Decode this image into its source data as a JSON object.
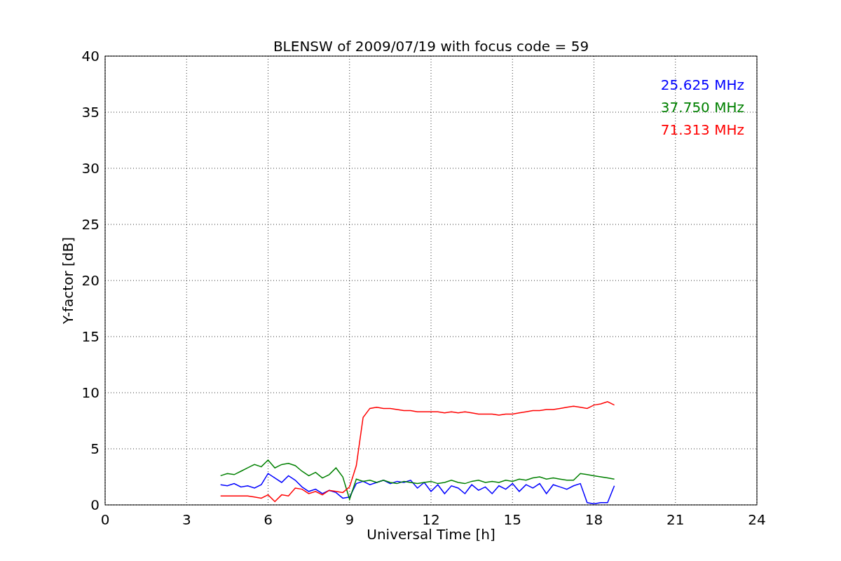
{
  "chart_data": {
    "type": "line",
    "title": "BLENSW of 2009/07/19 with focus code = 59",
    "xlabel": "Universal Time [h]",
    "ylabel": "Y-factor [dB]",
    "xlim": [
      0,
      24
    ],
    "ylim": [
      0,
      40
    ],
    "xticks": [
      0,
      3,
      6,
      9,
      12,
      15,
      18,
      21,
      24
    ],
    "yticks": [
      0,
      5,
      10,
      15,
      20,
      25,
      30,
      35,
      40
    ],
    "grid": true,
    "x": [
      4.25,
      4.5,
      4.75,
      5,
      5.25,
      5.5,
      5.75,
      6,
      6.25,
      6.5,
      6.75,
      7,
      7.25,
      7.5,
      7.75,
      8,
      8.25,
      8.5,
      8.75,
      9,
      9.25,
      9.5,
      9.75,
      10,
      10.25,
      10.5,
      10.75,
      11,
      11.25,
      11.5,
      11.75,
      12,
      12.25,
      12.5,
      12.75,
      13,
      13.25,
      13.5,
      13.75,
      14,
      14.25,
      14.5,
      14.75,
      15,
      15.25,
      15.5,
      15.75,
      16,
      16.25,
      16.5,
      16.75,
      17,
      17.25,
      17.5,
      17.75,
      18,
      18.25,
      18.5,
      18.75
    ],
    "series": [
      {
        "name": "25.625 MHz",
        "color": "#0000ff",
        "values": [
          1.8,
          1.7,
          1.9,
          1.6,
          1.7,
          1.5,
          1.8,
          2.8,
          2.4,
          2.0,
          2.6,
          2.2,
          1.6,
          1.2,
          1.4,
          1.0,
          1.3,
          1.1,
          0.6,
          0.7,
          1.9,
          2.1,
          1.8,
          2.0,
          2.2,
          1.9,
          2.1,
          2.0,
          2.2,
          1.5,
          2.0,
          1.2,
          1.8,
          1.0,
          1.7,
          1.5,
          1.0,
          1.8,
          1.3,
          1.6,
          1.0,
          1.7,
          1.4,
          1.9,
          1.2,
          1.8,
          1.5,
          1.9,
          1.0,
          1.8,
          1.6,
          1.4,
          1.7,
          1.9,
          0.2,
          0.1,
          0.2,
          0.2,
          1.7
        ]
      },
      {
        "name": "37.750 MHz",
        "color": "#008000",
        "values": [
          2.6,
          2.8,
          2.7,
          3.0,
          3.3,
          3.6,
          3.4,
          4.0,
          3.3,
          3.6,
          3.7,
          3.5,
          3.0,
          2.6,
          2.9,
          2.4,
          2.7,
          3.3,
          2.5,
          0.5,
          2.3,
          2.1,
          2.2,
          2.0,
          2.2,
          2.0,
          1.9,
          2.1,
          2.0,
          1.9,
          2.0,
          2.1,
          1.9,
          2.0,
          2.2,
          2.0,
          1.9,
          2.1,
          2.2,
          2.0,
          2.1,
          2.0,
          2.2,
          2.1,
          2.3,
          2.2,
          2.4,
          2.5,
          2.3,
          2.4,
          2.3,
          2.2,
          2.2,
          2.8,
          2.7,
          2.6,
          2.5,
          2.4,
          2.3
        ]
      },
      {
        "name": "71.313 MHz",
        "color": "#ff0000",
        "values": [
          0.8,
          0.8,
          0.8,
          0.8,
          0.8,
          0.7,
          0.6,
          0.9,
          0.3,
          0.9,
          0.8,
          1.5,
          1.4,
          1.0,
          1.2,
          0.9,
          1.3,
          1.2,
          1.1,
          1.6,
          3.5,
          7.8,
          8.6,
          8.7,
          8.6,
          8.6,
          8.5,
          8.4,
          8.4,
          8.3,
          8.3,
          8.3,
          8.3,
          8.2,
          8.3,
          8.2,
          8.3,
          8.2,
          8.1,
          8.1,
          8.1,
          8.0,
          8.1,
          8.1,
          8.2,
          8.3,
          8.4,
          8.4,
          8.5,
          8.5,
          8.6,
          8.7,
          8.8,
          8.7,
          8.6,
          8.9,
          9.0,
          9.2,
          8.9
        ]
      }
    ]
  }
}
